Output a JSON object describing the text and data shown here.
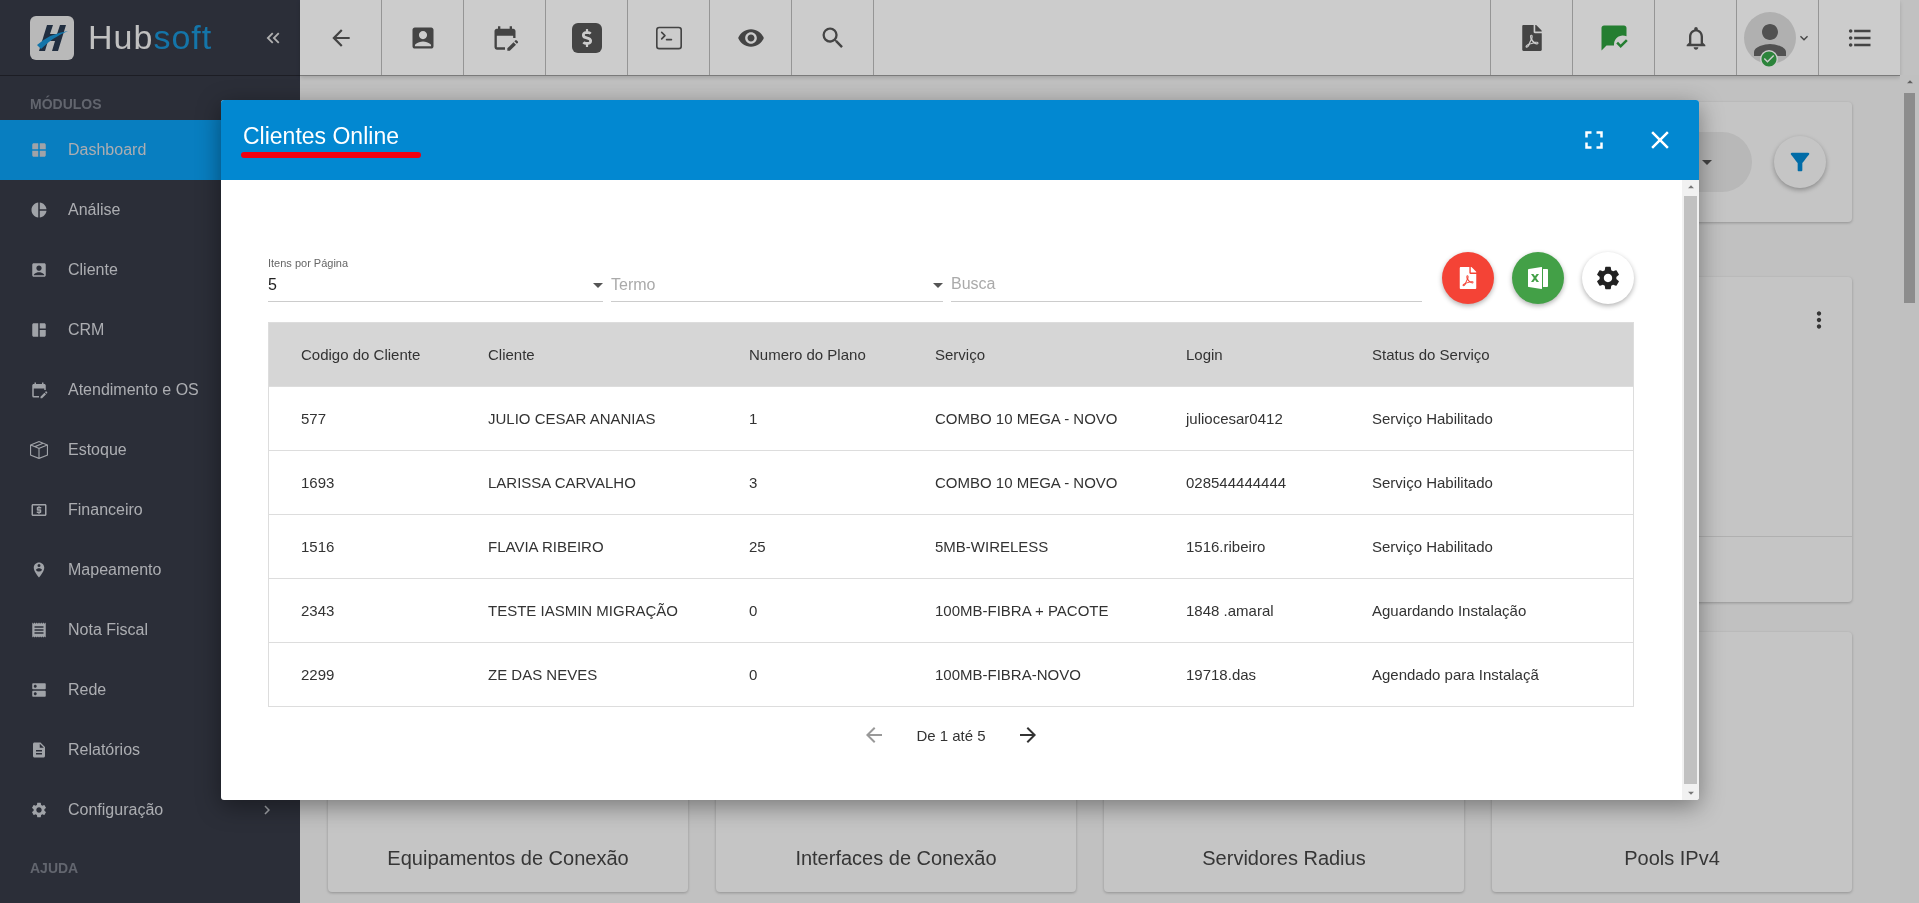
{
  "brand": {
    "parts": [
      "Hub",
      "soft"
    ]
  },
  "sidebar": {
    "sections": [
      {
        "heading": "MÓDULOS",
        "items": [
          {
            "label": "Dashboard",
            "selected": true
          },
          {
            "label": "Análise",
            "selected": false
          },
          {
            "label": "Cliente",
            "selected": false
          },
          {
            "label": "CRM",
            "selected": false
          },
          {
            "label": "Atendimento e OS",
            "selected": false
          },
          {
            "label": "Estoque",
            "selected": false
          },
          {
            "label": "Financeiro",
            "selected": false
          },
          {
            "label": "Mapeamento",
            "selected": false
          },
          {
            "label": "Nota Fiscal",
            "selected": false
          },
          {
            "label": "Rede",
            "selected": false
          },
          {
            "label": "Relatórios",
            "selected": false
          },
          {
            "label": "Configuração",
            "selected": false,
            "has_submenu": true
          }
        ]
      },
      {
        "heading": "AJUDA"
      }
    ]
  },
  "dashboard_cards": [
    "Equipamentos de Conexão",
    "Interfaces de Conexão",
    "Servidores Radius",
    "Pools IPv4"
  ],
  "modal": {
    "title": "Clientes Online",
    "per_page": {
      "label": "Itens por Página",
      "value": "5"
    },
    "term": {
      "placeholder": "Termo"
    },
    "search": {
      "placeholder": "Busca"
    },
    "table": {
      "columns": [
        "Codigo do Cliente",
        "Cliente",
        "Numero do Plano",
        "Serviço",
        "Login",
        "Status do Serviço"
      ],
      "rows": [
        [
          "577",
          "JULIO CESAR ANANIAS",
          "1",
          "COMBO 10 MEGA - NOVO",
          "juliocesar0412",
          "Serviço Habilitado"
        ],
        [
          "1693",
          "LARISSA CARVALHO",
          "3",
          "COMBO 10 MEGA - NOVO",
          "028544444444",
          "Serviço Habilitado"
        ],
        [
          "1516",
          "FLAVIA RIBEIRO",
          "25",
          "5MB-WIRELESS",
          "1516.ribeiro",
          "Serviço Habilitado"
        ],
        [
          "2343",
          "TESTE IASMIN MIGRAÇÃO",
          "0",
          "100MB-FIBRA + PACOTE",
          "1848 .amaral",
          "Aguardando Instalação"
        ],
        [
          "2299",
          "ZE DAS NEVES",
          "0",
          "100MB-FIBRA-NOVO",
          "19718.das",
          "Agendado para Instalaçã"
        ]
      ]
    },
    "pagination": {
      "range": "De 1 até 5"
    }
  }
}
